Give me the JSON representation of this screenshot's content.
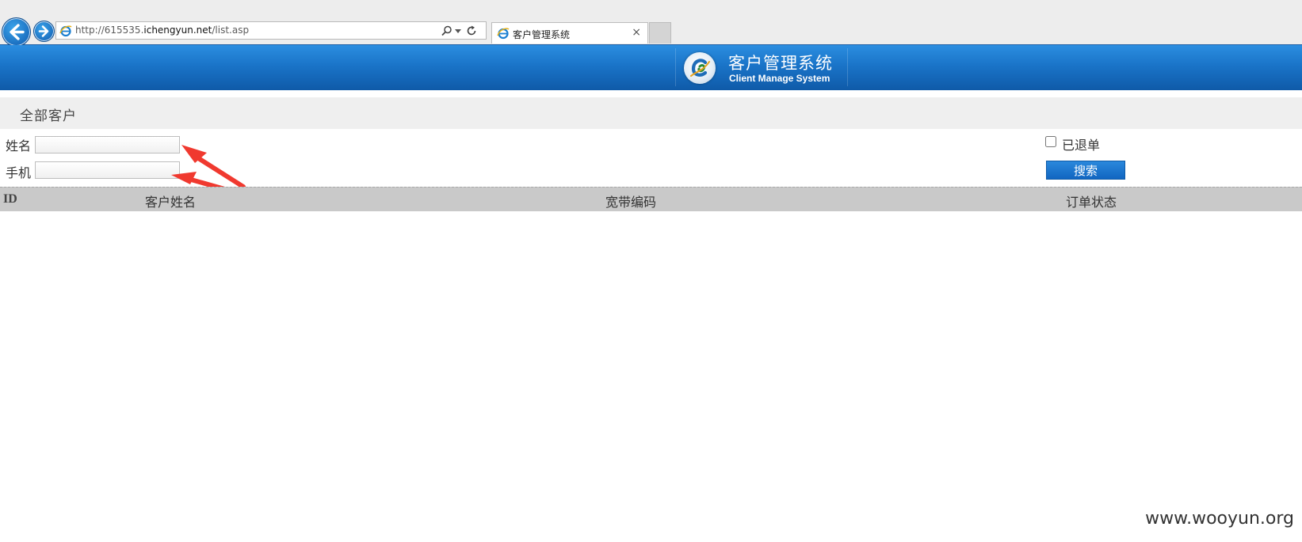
{
  "browser": {
    "url_prefix": "http://615535.",
    "url_domain": "ichengyun.net",
    "url_path": "/list.asp",
    "tab_title": "客户管理系统",
    "tab_close": "×"
  },
  "header": {
    "title_cn": "客户管理系统",
    "title_en": "Client Manage System"
  },
  "page": {
    "heading": "全部客户"
  },
  "search": {
    "name_label": "姓名",
    "name_value": "",
    "phone_label": "手机",
    "phone_value": "",
    "refunded_label": "已退单",
    "refunded_checked": false,
    "button_label": "搜索"
  },
  "table": {
    "columns": [
      "ID",
      "客户姓名",
      "宽带编码",
      "订单状态"
    ],
    "rows": []
  },
  "annotation": {
    "arrow_color": "#f0392f"
  },
  "watermark": "www.wooyun.org"
}
